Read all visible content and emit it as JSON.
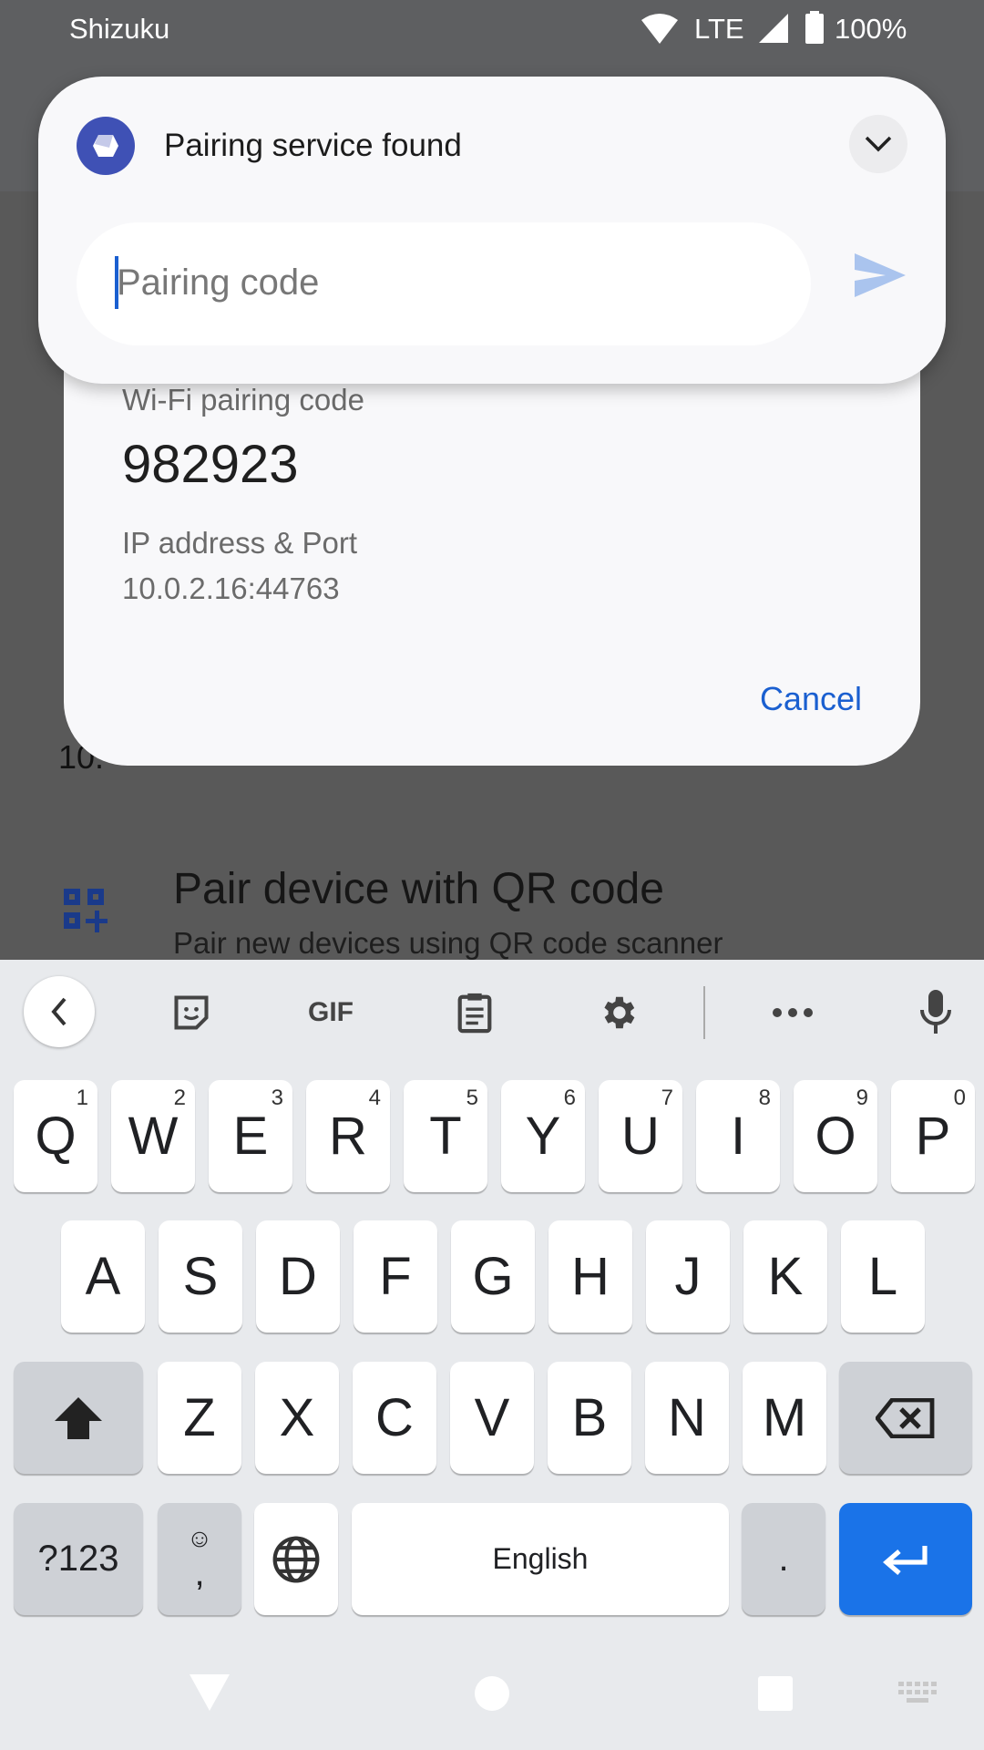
{
  "status_bar": {
    "app": "Shizuku",
    "network": "LTE",
    "battery": "100%"
  },
  "notification": {
    "title": "Pairing service found",
    "input_placeholder": "Pairing code",
    "input_value": ""
  },
  "dialog": {
    "code_label": "Wi-Fi pairing code",
    "code": "982923",
    "ip_label": "IP address & Port",
    "ip": "10.0.2.16:44763",
    "cancel": "Cancel"
  },
  "background": {
    "partial_text": "10.",
    "qr_title": "Pair device with QR code",
    "qr_subtitle": "Pair new devices using QR code scanner"
  },
  "keyboard": {
    "toolbar": [
      "back",
      "sticker",
      "GIF",
      "clipboard",
      "settings",
      "more",
      "microphone"
    ],
    "gif_label": "GIF",
    "row1": [
      {
        "k": "Q",
        "n": "1"
      },
      {
        "k": "W",
        "n": "2"
      },
      {
        "k": "E",
        "n": "3"
      },
      {
        "k": "R",
        "n": "4"
      },
      {
        "k": "T",
        "n": "5"
      },
      {
        "k": "Y",
        "n": "6"
      },
      {
        "k": "U",
        "n": "7"
      },
      {
        "k": "I",
        "n": "8"
      },
      {
        "k": "O",
        "n": "9"
      },
      {
        "k": "P",
        "n": "0"
      }
    ],
    "row2": [
      "A",
      "S",
      "D",
      "F",
      "G",
      "H",
      "J",
      "K",
      "L"
    ],
    "row3": [
      "Z",
      "X",
      "C",
      "V",
      "B",
      "N",
      "M"
    ],
    "symbols": "?123",
    "comma": ",",
    "space": "English",
    "period": ".",
    "enter_color": "#1a73e8"
  },
  "colors": {
    "accent": "#1a5fd0",
    "icon": "#3f51b5"
  }
}
